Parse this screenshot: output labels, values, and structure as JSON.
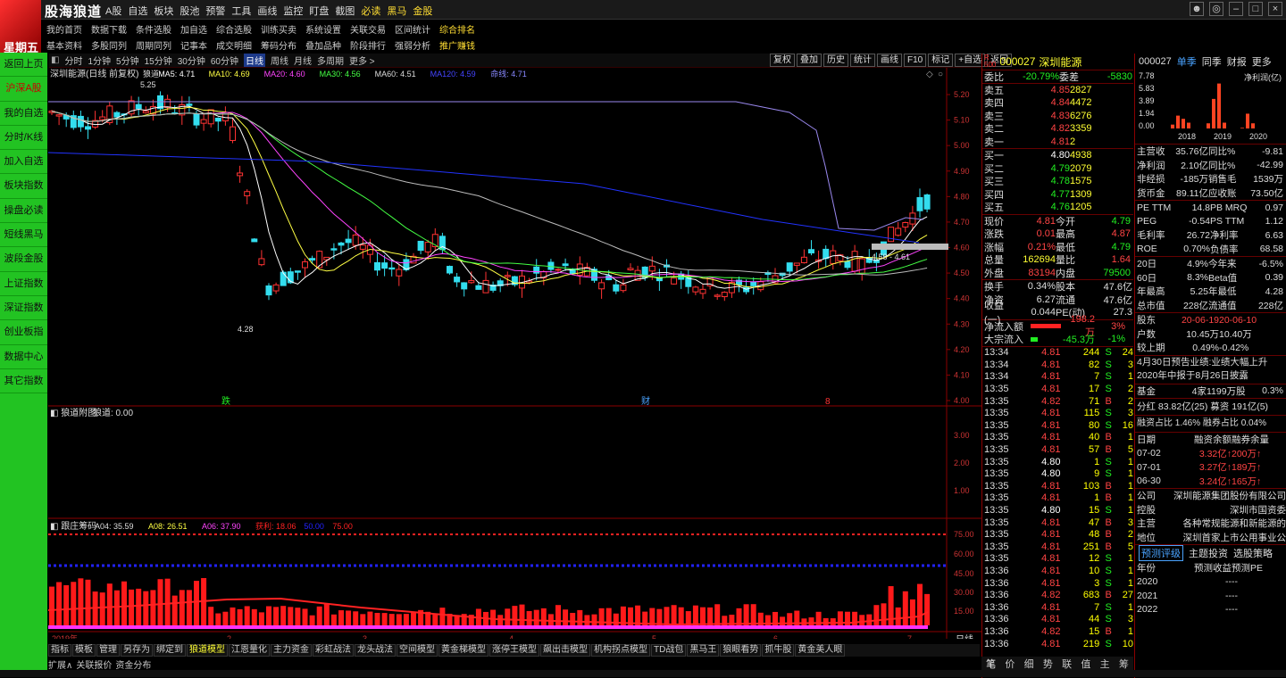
{
  "app": {
    "brand": "股海狼道",
    "day": "星期五"
  },
  "top_menu": [
    "A股",
    "自选",
    "板块",
    "股池",
    "预警",
    "工具",
    "画线",
    "监控",
    "盯盘",
    "截图",
    "必读",
    "黑马",
    "金股"
  ],
  "row2": [
    "我的首页",
    "数据下载",
    "条件选股",
    "加自选",
    "综合选股",
    "训练买卖",
    "系统设置",
    "关联交易",
    "区间统计",
    "综合排名"
  ],
  "row3": [
    "基本资料",
    "多股同列",
    "周期同列",
    "记事本",
    "成交明细",
    "筹码分布",
    "叠加品种",
    "阶段排行",
    "强弱分析",
    "推广赚钱"
  ],
  "sidebar": [
    "返回上页",
    "沪深A股",
    "我的自选",
    "分时/K线",
    "加入自选",
    "板块指数",
    "操盘必读",
    "短线黑马",
    "波段金股",
    "上证指数",
    "深证指数",
    "创业板指",
    "数据中心",
    "其它指数"
  ],
  "periods": [
    "分时",
    "1分钟",
    "5分钟",
    "15分钟",
    "30分钟",
    "60分钟",
    "日线",
    "周线",
    "月线",
    "多周期",
    "更多 >"
  ],
  "tools_right": [
    "复权",
    "叠加",
    "历史",
    "统计",
    "画线",
    "F10",
    "标记",
    "+自选",
    "返回"
  ],
  "chart_title": "深圳能源(日线 前复权)",
  "ma_legend": [
    {
      "t": "狼道",
      "c": "#dddddd"
    },
    {
      "t": "MA5: 4.71",
      "c": "#ffffff"
    },
    {
      "t": "MA10: 4.69",
      "c": "#ffff44"
    },
    {
      "t": "MA20: 4.60",
      "c": "#ff44ff"
    },
    {
      "t": "MA30: 4.56",
      "c": "#44ff44"
    },
    {
      "t": "MA60: 4.51",
      "c": "#dddddd"
    },
    {
      "t": "MA120: 4.59",
      "c": "#4444ff"
    },
    {
      "t": "命线: 4.71",
      "c": "#8888ff"
    }
  ],
  "price_ticks": [
    "5.20",
    "5.10",
    "5.00",
    "4.90",
    "4.80",
    "4.70",
    "4.60",
    "4.50",
    "4.40",
    "4.30",
    "4.20",
    "4.10",
    "4.00"
  ],
  "hi_label": "5.25",
  "lo_label": "4.28",
  "cur_label": "4.58 - 4.61",
  "markers": [
    "跌",
    "财",
    "8"
  ],
  "sub1": {
    "title": "狼道附图",
    "val": "狼道: 0.00",
    "ticks": [
      "3.00",
      "2.00",
      "1.00"
    ]
  },
  "sub2": {
    "title": "跟庄筹码",
    "legend": [
      {
        "t": "A04: 35.59",
        "c": "#dddddd"
      },
      {
        "t": "A08: 26.51",
        "c": "#ffff44"
      },
      {
        "t": "A06: 37.90",
        "c": "#ff44ff"
      },
      {
        "t": "获利: 18.06",
        "c": "#ff2222"
      },
      {
        "t": "50.00",
        "c": "#2222ff"
      },
      {
        "t": "75.00",
        "c": "#ff2222"
      }
    ],
    "ticks": [
      "75.00",
      "60.00",
      "45.00",
      "30.00",
      "15.00"
    ]
  },
  "x_axis": [
    "2019年",
    "2",
    "3",
    "4",
    "5",
    "6",
    "7"
  ],
  "period_label": "日线",
  "bottom_tabs": [
    "指标",
    "模板",
    "管理",
    "另存为",
    "绑定到",
    "狼道模型",
    "江恩量化",
    "主力资金",
    "彩虹战法",
    "龙头战法",
    "空间模型",
    "黄金梯模型",
    "涨停王模型",
    "飙出击模型",
    "机构拐点模型",
    "TD战包",
    "黑马王",
    "狼眼看势",
    "抓牛股",
    "黄金美人眼"
  ],
  "bottom2": [
    "扩展∧",
    "关联报价",
    "资金分布"
  ],
  "quote": {
    "code": "000027",
    "name": "深圳能源",
    "weibi": [
      "委比",
      "-20.79%",
      "委差",
      "-5830"
    ],
    "sells": [
      [
        "卖五",
        "4.85",
        "2827"
      ],
      [
        "卖四",
        "4.84",
        "4472"
      ],
      [
        "卖三",
        "4.83",
        "6276"
      ],
      [
        "卖二",
        "4.82",
        "3359"
      ],
      [
        "卖一",
        "4.81",
        "2"
      ]
    ],
    "buys": [
      [
        "买一",
        "4.80",
        "4938"
      ],
      [
        "买二",
        "4.79",
        "2079"
      ],
      [
        "买三",
        "4.78",
        "1575"
      ],
      [
        "买四",
        "4.77",
        "1309"
      ],
      [
        "买五",
        "4.76",
        "1205"
      ]
    ],
    "stats": [
      [
        "现价",
        "4.81",
        "今开",
        "4.79"
      ],
      [
        "涨跌",
        "0.01",
        "最高",
        "4.87"
      ],
      [
        "涨幅",
        "0.21%",
        "最低",
        "4.79"
      ],
      [
        "总量",
        "162694",
        "量比",
        "1.64"
      ],
      [
        "外盘",
        "83194",
        "内盘",
        "79500"
      ]
    ],
    "stats2": [
      [
        "换手",
        "0.34%",
        "股本",
        "47.6亿"
      ],
      [
        "净资",
        "6.27",
        "流通",
        "47.6亿"
      ],
      [
        "收益(一)",
        "0.044",
        "PE(动)",
        "27.3"
      ]
    ],
    "flow": [
      [
        "净流入额",
        "198.2万",
        "3%"
      ],
      [
        "大宗流入",
        "-45.3万",
        "-1%"
      ]
    ],
    "ticks": [
      [
        "13:34",
        "4.81",
        "244",
        "S",
        "24"
      ],
      [
        "13:34",
        "4.81",
        "82",
        "S",
        "3"
      ],
      [
        "13:34",
        "4.81",
        "7",
        "S",
        "1"
      ],
      [
        "13:35",
        "4.81",
        "17",
        "S",
        "2"
      ],
      [
        "13:35",
        "4.82",
        "71",
        "B",
        "2"
      ],
      [
        "13:35",
        "4.81",
        "115",
        "S",
        "3"
      ],
      [
        "13:35",
        "4.81",
        "80",
        "S",
        "16"
      ],
      [
        "13:35",
        "4.81",
        "40",
        "B",
        "1"
      ],
      [
        "13:35",
        "4.81",
        "57",
        "B",
        "5"
      ],
      [
        "13:35",
        "4.80",
        "1",
        "S",
        "1"
      ],
      [
        "13:35",
        "4.80",
        "9",
        "S",
        "1"
      ],
      [
        "13:35",
        "4.81",
        "103",
        "B",
        "1"
      ],
      [
        "13:35",
        "4.81",
        "1",
        "B",
        "1"
      ],
      [
        "13:35",
        "4.80",
        "15",
        "S",
        "1"
      ],
      [
        "13:35",
        "4.81",
        "47",
        "B",
        "3"
      ],
      [
        "13:35",
        "4.81",
        "48",
        "B",
        "2"
      ],
      [
        "13:35",
        "4.81",
        "251",
        "B",
        "5"
      ],
      [
        "13:35",
        "4.81",
        "12",
        "S",
        "1"
      ],
      [
        "13:36",
        "4.81",
        "10",
        "S",
        "1"
      ],
      [
        "13:36",
        "4.81",
        "3",
        "S",
        "1"
      ],
      [
        "13:36",
        "4.82",
        "683",
        "B",
        "27"
      ],
      [
        "13:36",
        "4.81",
        "7",
        "S",
        "1"
      ],
      [
        "13:36",
        "4.81",
        "44",
        "S",
        "3"
      ],
      [
        "13:36",
        "4.82",
        "15",
        "B",
        "1"
      ],
      [
        "13:36",
        "4.81",
        "219",
        "S",
        "10"
      ]
    ],
    "tabs": [
      "笔",
      "价",
      "细",
      "势",
      "联",
      "值",
      "主",
      "筹"
    ]
  },
  "fund": {
    "code": "000027",
    "tabs": [
      "单季",
      "同季",
      "财报",
      "更多"
    ],
    "bar_axis": [
      "7.78",
      "5.83",
      "3.89",
      "1.94",
      "0.00"
    ],
    "bar_title": "净利润(亿)",
    "years": [
      "2018",
      "2019",
      "2020"
    ],
    "bar_values": [
      0.6,
      2.0,
      1.5,
      0.9,
      0.8,
      4.6,
      7.0,
      0.9,
      0.1,
      2.3,
      0.8
    ],
    "f1": [
      [
        "主营收",
        "35.76亿",
        "同比%",
        "-9.81"
      ],
      [
        "净利润",
        "2.10亿",
        "同比%",
        "-42.99"
      ],
      [
        "非经损",
        "-185万",
        "销售毛",
        "1539万"
      ],
      [
        "货币金",
        "89.11亿",
        "应收账",
        "73.50亿"
      ]
    ],
    "f2": [
      [
        "PE TTM",
        "14.8",
        "PB MRQ",
        "0.97"
      ],
      [
        "PEG",
        "-0.54",
        "PS TTM",
        "1.12"
      ],
      [
        "毛利率",
        "26.72",
        "净利率",
        "6.63"
      ],
      [
        "ROE",
        "0.70%",
        "负债率",
        "68.58"
      ]
    ],
    "f3": [
      [
        "20日",
        "4.9%",
        "今年来",
        "-6.5%"
      ],
      [
        "60日",
        "8.3%",
        "Beta值",
        "0.39"
      ],
      [
        "年最高",
        "5.25",
        "年最低",
        "4.28"
      ],
      [
        "总市值",
        "228亿",
        "流通值",
        "228亿"
      ]
    ],
    "holders": [
      [
        "股东",
        "20-06-19",
        "20-06-10"
      ],
      [
        "户数",
        "10.45万",
        "10.40万"
      ],
      [
        "较上期",
        "0.49%",
        "-0.42%"
      ]
    ],
    "news": [
      "4月30日预告业绩:业绩大幅上升",
      "2020年中报于8月26日披露"
    ],
    "jijin": [
      "基金",
      "4家",
      "1199万股",
      "0.3%"
    ],
    "fenhong": "分红 83.82亿(25) 募资 191亿(5)",
    "rongzi": "融资占比 1.46% 融券占比 0.04%",
    "margin_head": [
      "日期",
      "融资余额",
      "融券余量"
    ],
    "margin": [
      [
        "07-02",
        "3.32亿↑",
        "200万↑"
      ],
      [
        "07-01",
        "3.27亿↑",
        "189万↑"
      ],
      [
        "06-30",
        "3.24亿↑",
        "165万↑"
      ]
    ],
    "company": [
      [
        "公司",
        "深圳能源集团股份有限公司"
      ],
      [
        "控股",
        "深圳市国资委"
      ],
      [
        "主营",
        "各种常规能源和新能源的"
      ],
      [
        "地位",
        "深圳首家上市公用事业公"
      ]
    ],
    "pred_tabs": [
      "预测评级",
      "主题投资",
      "选股策略"
    ],
    "pred_head": [
      "年份",
      "预测收益",
      "预测PE"
    ],
    "pred": [
      [
        "2020",
        "--",
        "--"
      ],
      [
        "2021",
        "--",
        "--"
      ],
      [
        "2022",
        "--",
        "--"
      ]
    ]
  }
}
